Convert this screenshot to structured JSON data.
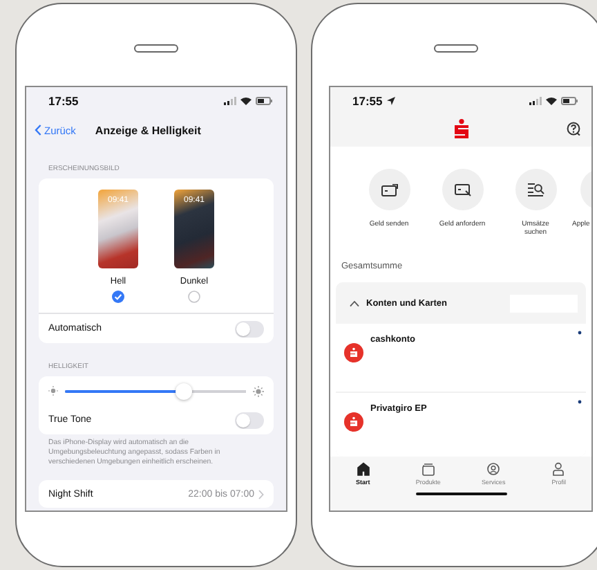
{
  "settings_screen": {
    "status_time": "17:55",
    "back_label": "Zurück",
    "title": "Anzeige & Helligkeit",
    "appearance_header": "ERSCHEINUNGSBILD",
    "appearance_options": [
      {
        "label": "Hell",
        "preview_time": "09:41",
        "kind": "light",
        "selected": true
      },
      {
        "label": "Dunkel",
        "preview_time": "09:41",
        "kind": "dark",
        "selected": false
      }
    ],
    "automatic": {
      "label": "Automatisch",
      "on": false
    },
    "brightness_header": "HELLIGKEIT",
    "brightness": {
      "level": 0.66
    },
    "true_tone": {
      "label": "True Tone",
      "on": false
    },
    "footnote": "Das iPhone-Display wird automatisch an die Umgebungsbeleuchtung angepasst, sodass Farben in verschiedenen Umgebungen einheitlich erscheinen.",
    "night_shift": {
      "label": "Night Shift",
      "value": "22:00 bis 07:00"
    }
  },
  "banking_screen": {
    "status_time": "17:55",
    "actions": [
      {
        "label": "Geld senden",
        "kind": "send"
      },
      {
        "label": "Geld anfordern",
        "kind": "request"
      },
      {
        "label": "Umsätze suchen",
        "kind": "search"
      },
      {
        "label": "Apple",
        "kind": "wallet"
      }
    ],
    "total_label": "Gesamtsumme",
    "accounts_section": {
      "title": "Konten und Karten",
      "expanded": true
    },
    "accounts": [
      {
        "name": "cashkonto"
      },
      {
        "name": "Privatgiro EP"
      }
    ],
    "tabs": [
      {
        "label": "Start",
        "kind": "home",
        "selected": true
      },
      {
        "label": "Produkte",
        "kind": "products",
        "selected": false
      },
      {
        "label": "Services",
        "kind": "services",
        "selected": false
      },
      {
        "label": "Profil",
        "kind": "profile",
        "selected": false
      }
    ]
  }
}
